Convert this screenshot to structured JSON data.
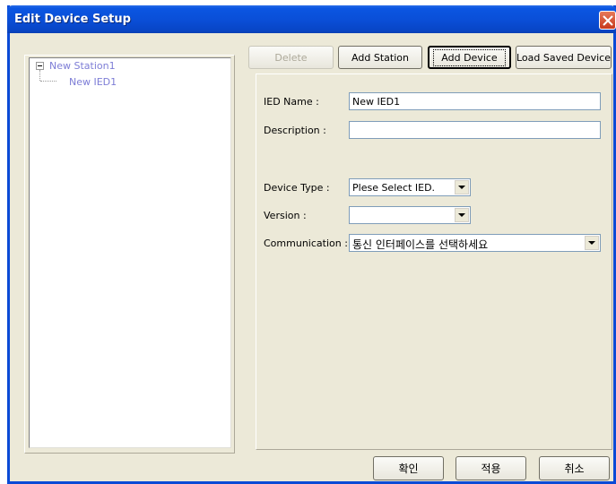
{
  "window": {
    "title": "Edit Device Setup",
    "close_icon": "close-icon"
  },
  "tree": {
    "station": "New Station1",
    "device": "New IED1"
  },
  "toolbar": {
    "delete_label": "Delete",
    "add_station_label": "Add Station",
    "add_device_label": "Add Device",
    "load_saved_label": "Load Saved Device"
  },
  "form": {
    "ied_name_label": "IED Name :",
    "ied_name_value": "New IED1",
    "description_label": "Description :",
    "description_value": "",
    "device_type_label": "Device Type :",
    "device_type_value": "Plese Select IED.",
    "version_label": "Version :",
    "version_value": "",
    "communication_label": "Communication :",
    "communication_value": "통신 인터페이스를 선택하세요"
  },
  "footer": {
    "ok_label": "확인",
    "apply_label": "적용",
    "cancel_label": "취소"
  },
  "colors": {
    "titlebar": "#0a4fd8",
    "dialog_bg": "#ece9d8",
    "tree_text": "#7d7dd6"
  }
}
